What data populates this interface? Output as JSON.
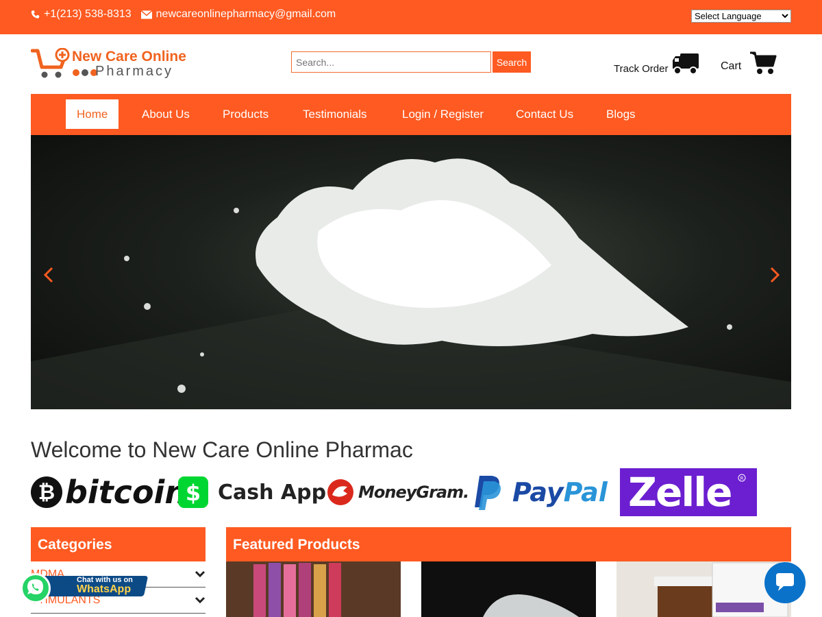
{
  "topbar": {
    "phone": "+1(213) 538-8313",
    "email": "newcareonlinepharmacy@gmail.com",
    "language_select": "Select Language",
    "phone_icon": "phone-icon",
    "email_icon": "envelope-icon"
  },
  "header": {
    "logo_line1": "New Care Online",
    "logo_line2": "Pharmacy",
    "search_placeholder": "Search...",
    "search_button": "Search",
    "track_order": "Track Order",
    "cart": "Cart"
  },
  "nav": {
    "items": [
      "Home",
      "About Us",
      "Products",
      "Testimonials",
      "Login / Register",
      "Contact Us",
      "Blogs"
    ],
    "active": "Home"
  },
  "welcome": "Welcome to New Care Online Pharmac",
  "payments": {
    "bitcoin": "bitcoin",
    "cashapp": "Cash App",
    "moneygram": "MoneyGram.",
    "paypal_pay": "Pay",
    "paypal_pal": "Pal",
    "zelle": "Zelle"
  },
  "categories": {
    "title": "Categories",
    "items": [
      "MDMA",
      "STIMULANTS"
    ]
  },
  "featured": {
    "title": "Featured Products"
  },
  "whatsapp": {
    "line1": "Chat with us on",
    "line2": "WhatsApp"
  },
  "colors": {
    "accent": "#fe5a21",
    "zelle": "#6b1fd0",
    "paypal_dark": "#1b4aa5",
    "paypal_light": "#2a94d8"
  }
}
